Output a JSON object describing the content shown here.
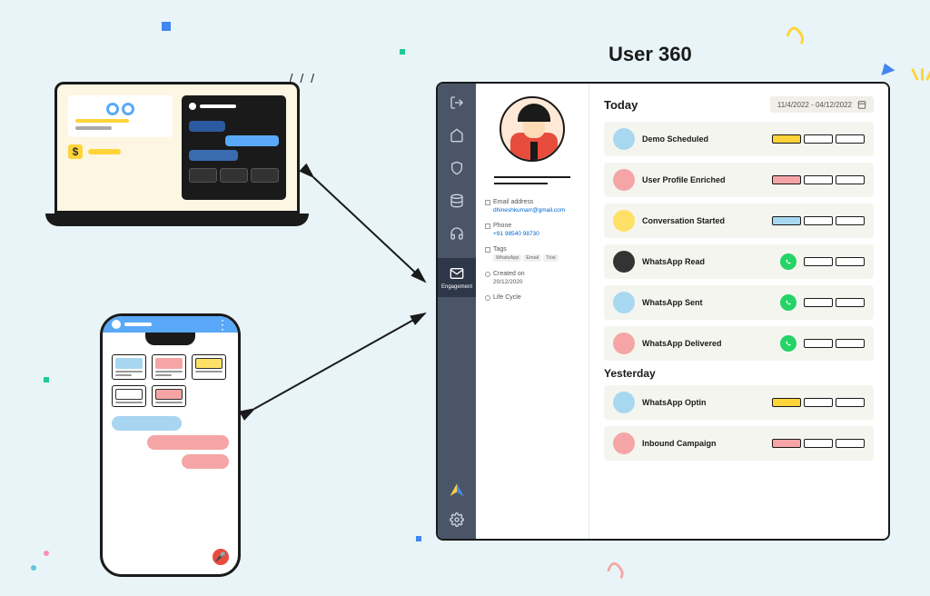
{
  "title": "User 360",
  "dateRange": "11/4/2022 - 04/12/2022",
  "profile": {
    "email": {
      "label": "Email address",
      "value": "dhineshkumarr@gmail.com"
    },
    "phone": {
      "label": "Phone",
      "value": "+91 98540 98730"
    },
    "tags": {
      "label": "Tags",
      "items": [
        "WhatsApp",
        "Email",
        "Trial"
      ]
    },
    "createdOn": {
      "label": "Created on",
      "value": "20/12/2020"
    },
    "lifeCycle": {
      "label": "Life Cycle"
    }
  },
  "nav": {
    "engagement": "Engagement"
  },
  "sections": {
    "today": "Today",
    "yesterday": "Yesterday"
  },
  "events": {
    "today": [
      {
        "label": "Demo Scheduled",
        "dot": "blue",
        "bar": "yellow"
      },
      {
        "label": "User Profile Enriched",
        "dot": "pink",
        "bar": "red"
      },
      {
        "label": "Conversation Started",
        "dot": "yellow",
        "bar": "blue"
      },
      {
        "label": "WhatsApp Read",
        "dot": "dark",
        "wa": true
      },
      {
        "label": "WhatsApp Sent",
        "dot": "blue",
        "wa": true
      },
      {
        "label": "WhatsApp Delivered",
        "dot": "pink",
        "wa": true
      }
    ],
    "yesterday": [
      {
        "label": "WhatsApp Optin",
        "dot": "blue",
        "bar": "yellow"
      },
      {
        "label": "Inbound Campaign",
        "dot": "pink",
        "bar": "red"
      }
    ]
  }
}
